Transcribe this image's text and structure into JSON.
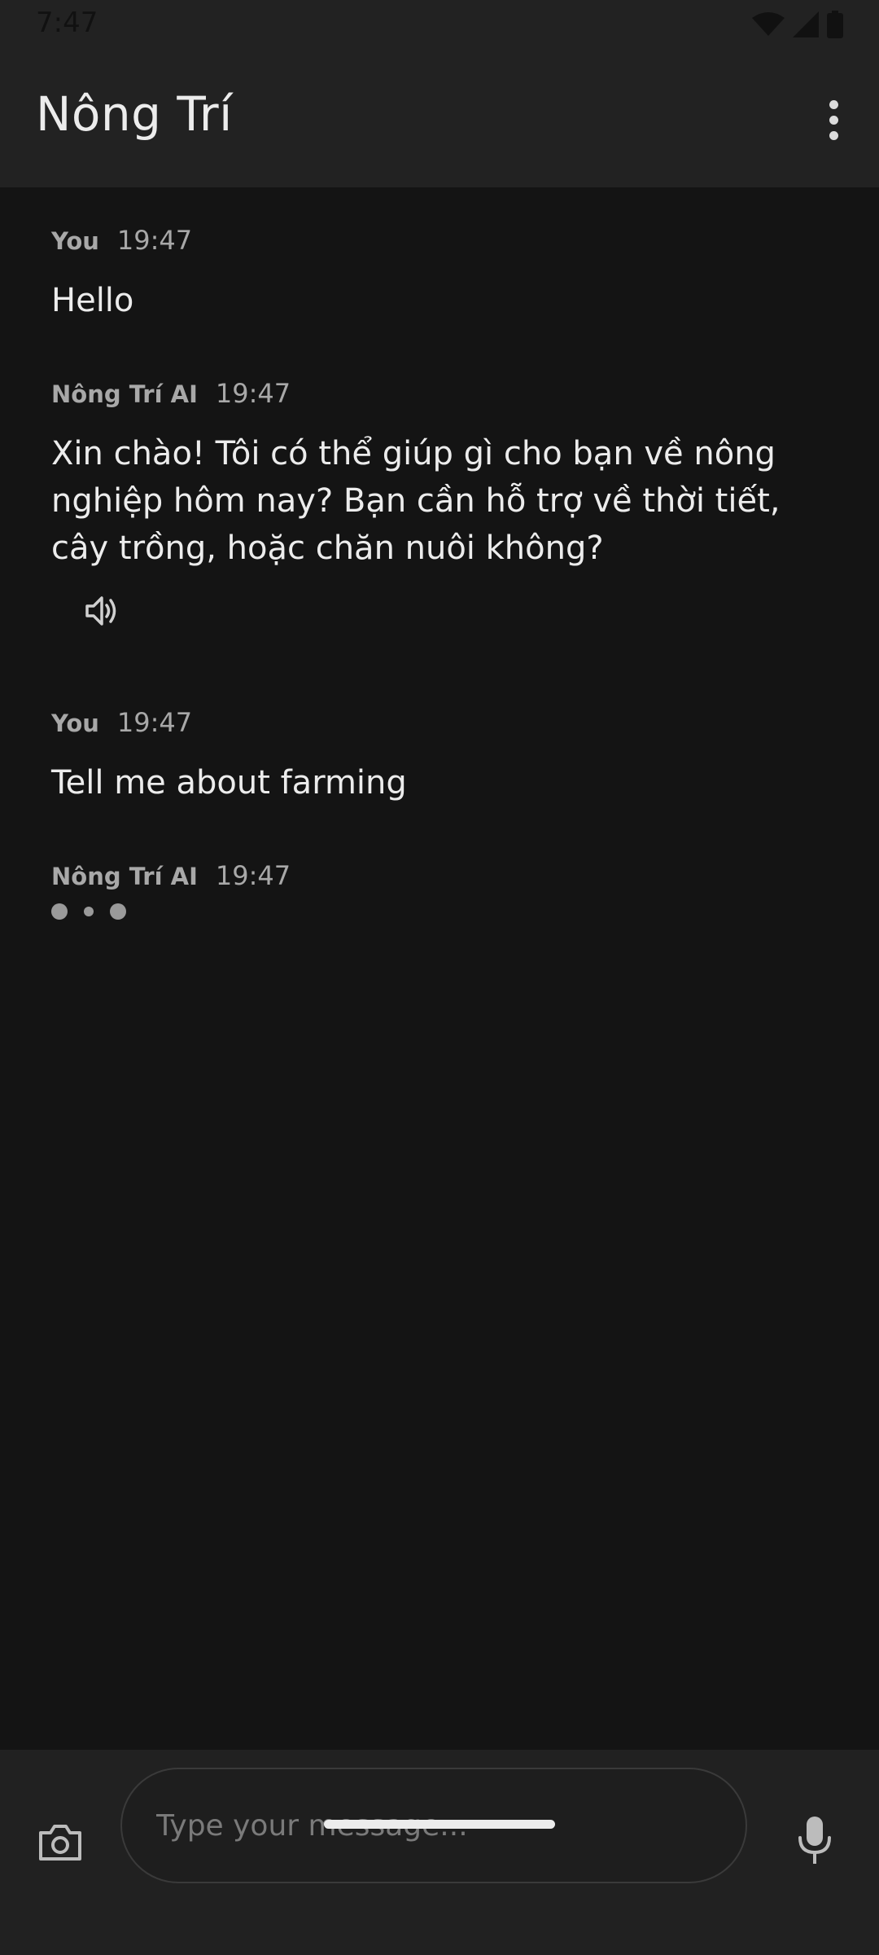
{
  "status_bar": {
    "time": "7:47",
    "icons": [
      "wifi-icon",
      "signal-icon",
      "battery-icon"
    ]
  },
  "app_bar": {
    "title": "Nông Trí",
    "menu_icon": "more-vert-icon"
  },
  "messages": [
    {
      "sender": "You",
      "time": "19:47",
      "text": "Hello"
    },
    {
      "sender": "Nông Trí AI",
      "time": "19:47",
      "text": "Xin chào! Tôi có thể giúp gì cho bạn về nông nghiệp hôm nay? Bạn cần hỗ trợ về thời tiết, cây trồng, hoặc chăn nuôi không?",
      "action_icon": "speaker-icon"
    },
    {
      "sender": "You",
      "time": "19:47",
      "text": "Tell me about farming"
    },
    {
      "sender": "Nông Trí AI",
      "time": "19:47",
      "typing": true
    }
  ],
  "input": {
    "placeholder": "Type your message...",
    "value": "",
    "camera_icon": "camera-icon",
    "mic_icon": "microphone-icon"
  },
  "colors": {
    "background": "#141414",
    "bar": "#222222",
    "text_primary": "#ececec",
    "text_secondary": "#a8a8a8"
  }
}
